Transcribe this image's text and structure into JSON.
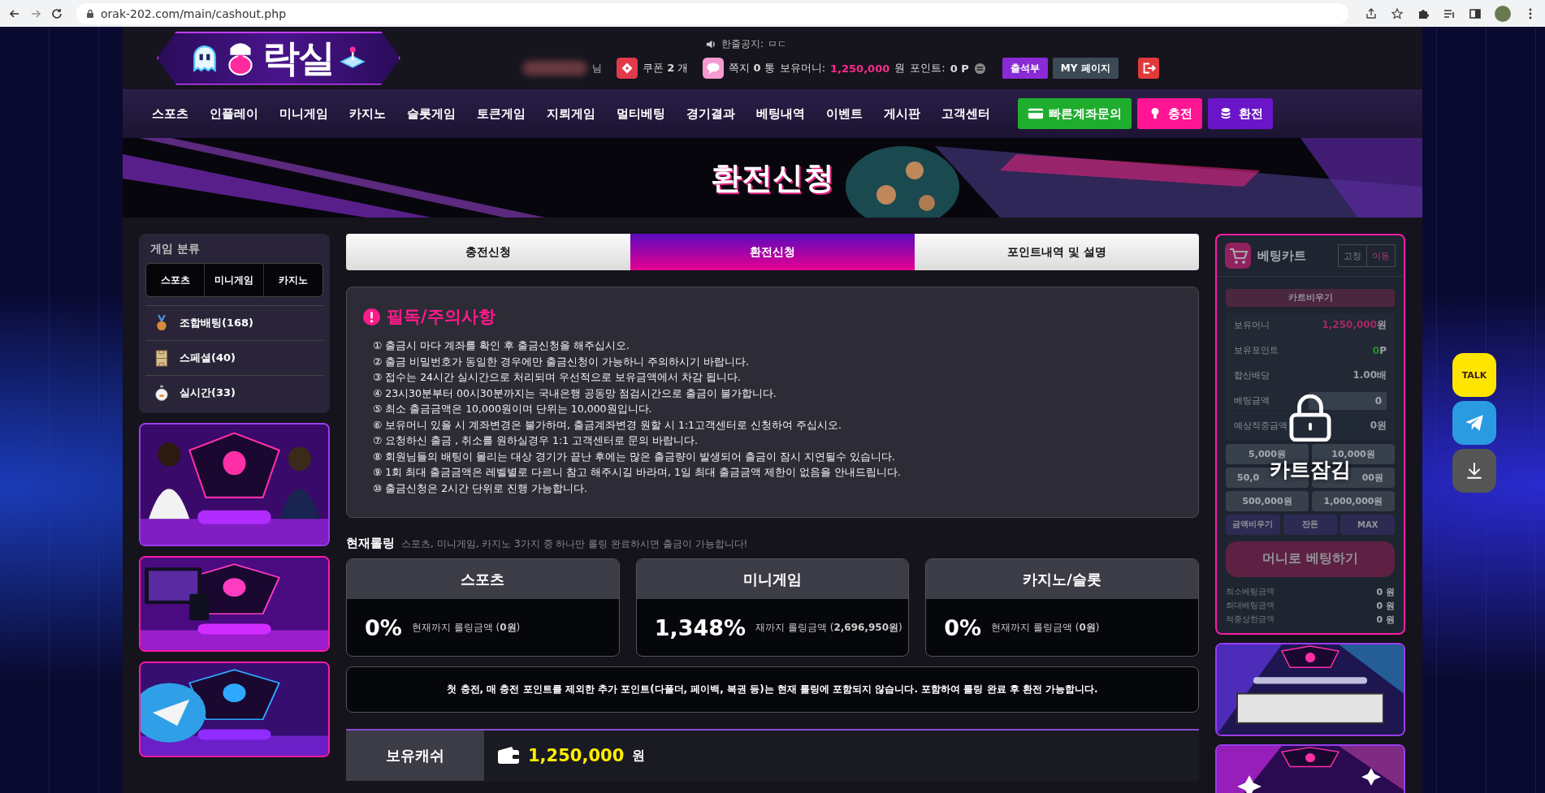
{
  "browser": {
    "url": "orak-202.com/main/cashout.php"
  },
  "header": {
    "logo_text": "락실",
    "notice_label": "한줄공지:",
    "notice_text": "ㅁㄷ",
    "user_suffix": "님",
    "coupon": "쿠폰 **2** 개",
    "message": "쪽지 **0** 통",
    "money_label": "보유머니:",
    "money_value": "1,250,000",
    "money_unit": "원",
    "point_label": "포인트:",
    "point_value": "0 P",
    "buttons": [
      {
        "label": "출석부",
        "kind": "attendance"
      },
      {
        "label": "MY 페이지",
        "kind": "mypage"
      }
    ]
  },
  "nav": {
    "items": [
      "스포츠",
      "인플레이",
      "미니게임",
      "카지노",
      "슬롯게임",
      "토큰게임",
      "지뢰게임",
      "멀티베팅",
      "경기결과",
      "베팅내역",
      "이벤트",
      "게시판",
      "고객센터"
    ],
    "quick_buttons": [
      {
        "label": "빠른계좌문의",
        "kind": "account"
      },
      {
        "label": "충전",
        "kind": "deposit"
      },
      {
        "label": "환전",
        "kind": "withdraw"
      }
    ]
  },
  "hero": {
    "title": "환전신청"
  },
  "sidebar": {
    "heading": "게임 분류",
    "tabs": [
      "스포츠",
      "미니게임",
      "카지노"
    ],
    "categories": [
      {
        "label": "조합배팅(168)",
        "kind": "medal"
      },
      {
        "label": "스페셜(40)",
        "kind": "field"
      },
      {
        "label": "실시간(33)",
        "kind": "stopwatch"
      }
    ]
  },
  "tabs": [
    {
      "label": "충전신청",
      "selected": false
    },
    {
      "label": "환전신청",
      "selected": true
    },
    {
      "label": "포인트내역 및 설명",
      "selected": false
    }
  ],
  "notice": {
    "title": "필독/주의사항",
    "items": [
      "① 출금시 마다 계좌를 확인 후 출금신청을 해주십시오.",
      "② 출금 비밀번호가 동일한 경우에만 출금신청이 가능하니 주의하시기 바랍니다.",
      "③ 접수는 24시간 실시간으로 처리되며 우선적으로 보유금액에서 차감 됩니다.",
      "④ 23시30분부터 00시30분까지는 국내은행 공동망 점검시간으로 출금이 불가합니다.",
      "⑤ 최소 출금금액은 10,000원이며 단위는 10,000원입니다.",
      "⑥ 보유머니 있을 시 계좌변경은 불가하며, 출금계좌변경 원할 시 1:1고객센터로 신청하여 주십시오.",
      "⑦ 요청하신 출금 , 취소를 원하실경우 1:1 고객센터로 문의 바랍니다.",
      "⑧ 회원님들의 배팅이 몰리는 대상 경기가 끝난 후에는 많은 출금량이 발생되어 출금이 잠시 지연될수 있습니다.",
      "⑨ 1회 최대 출금금액은 레벨별로 다르니 참고 해주시길 바라며, 1일 최대 출금금액 제한이 없음을 안내드립니다.",
      "⑩ 출금신청은 2시간 단위로 진행 가능합니다."
    ]
  },
  "rolling": {
    "title": "현재롤링",
    "hint": "스포츠, 미니게임, 카지노 3가지 중 하나만 롤링 완료하시면 출금이 가능합니다!",
    "cards": [
      {
        "title": "스포츠",
        "percent": "0%",
        "detail": "현재까지 롤링금액 (**0원**)"
      },
      {
        "title": "미니게임",
        "percent": "1,348%",
        "detail": "재까지 롤링금액 (**2,696,950원**)"
      },
      {
        "title": "카지노/슬롯",
        "percent": "0%",
        "detail": "현재까지 롤링금액 (**0원**)"
      }
    ],
    "note": "첫 충전, 매 충전 포인트를 제외한 추가 포인트(다폴더, 페이백, 복권 등)는 현재 롤링에 포함되지 않습니다. 포함하여 롤링 완료 후 환전 가능합니다."
  },
  "cash": {
    "label": "보유캐쉬",
    "amount": "1,250,000",
    "unit": "원"
  },
  "cart": {
    "title": "베팅카트",
    "locked": true,
    "lock_label": "카트잠김",
    "modes": [
      {
        "label": "고정",
        "selected": false
      },
      {
        "label": "이동",
        "selected": true
      }
    ],
    "clear_label": "카트비우기",
    "rows": [
      {
        "label": "보유머니",
        "value": "1,250,000",
        "unit": "원",
        "kind": "money"
      },
      {
        "label": "보유포인트",
        "value": "0",
        "unit": "P",
        "kind": "point"
      },
      {
        "label": "합산배당",
        "value": "1.00",
        "unit": "배",
        "kind": "odds"
      },
      {
        "label": "베팅금액",
        "value": "0",
        "kind": "input"
      },
      {
        "label": "예상적중금액",
        "value": "0원",
        "kind": "plain"
      }
    ],
    "amounts": [
      {
        "label": "5,000원",
        "covered": false
      },
      {
        "label": "10,000원",
        "covered": false
      },
      {
        "label": "50,0",
        "covered": true
      },
      {
        "label": "00원",
        "covered": true
      },
      {
        "label": "500,000원",
        "covered": false
      },
      {
        "label": "1,000,000원",
        "covered": false
      }
    ],
    "actions": [
      "금액비우기",
      "잔돈",
      "MAX"
    ],
    "bet_label": "머니로 베팅하기",
    "limits": [
      {
        "label": "최소베팅금액",
        "value": "0",
        "unit": "원"
      },
      {
        "label": "최대베팅금액",
        "value": "0",
        "unit": "원"
      },
      {
        "label": "적중상한금액",
        "value": "0",
        "unit": "원"
      }
    ]
  },
  "floating": [
    {
      "kind": "talk",
      "label": "TALK"
    },
    {
      "kind": "telegram"
    },
    {
      "kind": "download"
    }
  ]
}
